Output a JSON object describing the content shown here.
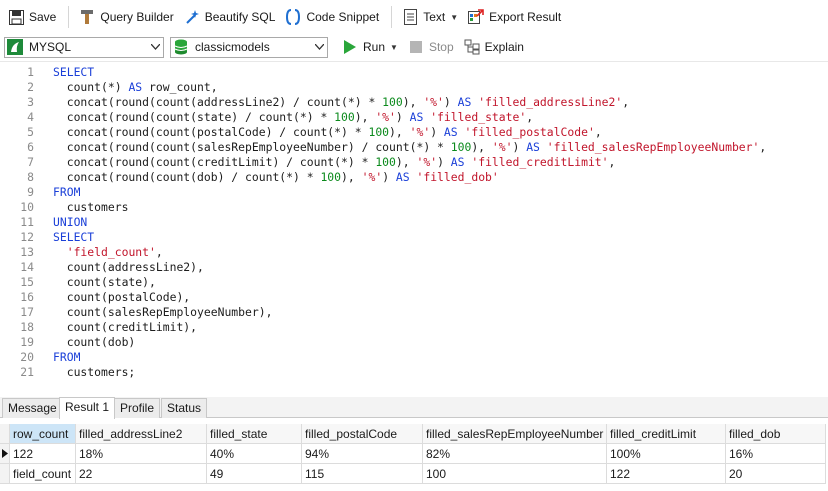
{
  "toolbar": {
    "save": "Save",
    "query_builder": "Query Builder",
    "beautify": "Beautify SQL",
    "code_snippet": "Code Snippet",
    "text": "Text",
    "export": "Export Result"
  },
  "connection": {
    "server": "MYSQL",
    "database": "classicmodels",
    "run": "Run",
    "stop": "Stop",
    "explain": "Explain"
  },
  "editor": {
    "line_numbers": [
      "1",
      "2",
      "3",
      "4",
      "5",
      "6",
      "7",
      "8",
      "9",
      "10",
      "11",
      "12",
      "13",
      "14",
      "15",
      "16",
      "17",
      "18",
      "19",
      "20",
      "21"
    ]
  },
  "result_tabs": [
    "Message",
    "Result 1",
    "Profile",
    "Status"
  ],
  "active_tab": "Result 1",
  "grid": {
    "columns": [
      "row_count",
      "filled_addressLine2",
      "filled_state",
      "filled_postalCode",
      "filled_salesRepEmployeeNumber",
      "filled_creditLimit",
      "filled_dob"
    ],
    "rows": [
      [
        "122",
        "18%",
        "40%",
        "94%",
        "82%",
        "100%",
        "16%"
      ],
      [
        "field_count",
        "22",
        "49",
        "115",
        "100",
        "122",
        "20"
      ]
    ]
  },
  "colors": {
    "keyword": "#1a3fd8",
    "string": "#c1152b",
    "number": "#0b8a1c",
    "selected_header": "#cde5f7"
  }
}
